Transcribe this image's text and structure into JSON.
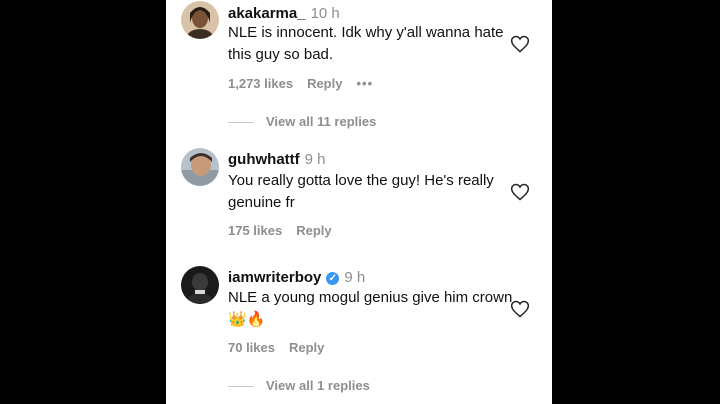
{
  "comments": [
    {
      "username": "akakarma_",
      "time": "10 h",
      "text": "NLE is innocent. Idk why y'all wanna hate this guy so bad.",
      "likes": "1,273 likes",
      "reply": "Reply",
      "more": "•••",
      "view_replies": "View all 11 replies"
    },
    {
      "username": "guhwhattf",
      "time": "9 h",
      "text": "You really gotta love the guy! He's really genuine fr",
      "likes": "175 likes",
      "reply": "Reply"
    },
    {
      "username": "iamwriterboy",
      "time": "9 h",
      "text": "NLE a young mogul genius give him crown 👑🔥",
      "likes": "70 likes",
      "reply": "Reply",
      "view_replies": "View all 1 replies"
    }
  ],
  "icons": {
    "heart": "heart-outline-icon",
    "verified": "verified-badge-icon",
    "more": "more-options-icon"
  },
  "colors": {
    "verified": "#3897f0",
    "muted": "#8e8e8e"
  }
}
